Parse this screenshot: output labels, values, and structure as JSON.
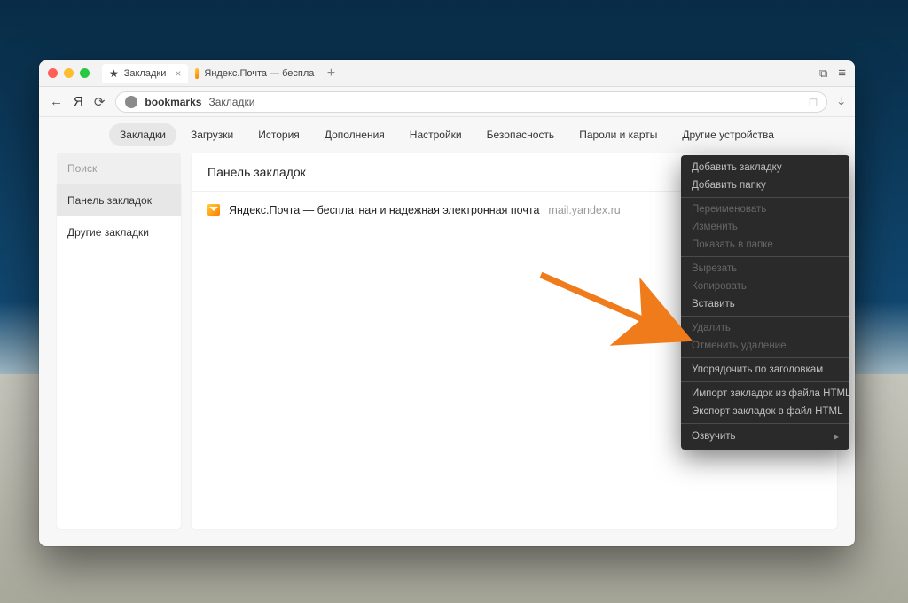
{
  "tabs": [
    {
      "title": "Закладки",
      "active": true
    },
    {
      "title": "Яндекс.Почта — беспла",
      "active": false
    }
  ],
  "omni": {
    "host": "bookmarks",
    "crumb": "Закладки"
  },
  "navtabs": {
    "items": [
      "Закладки",
      "Загрузки",
      "История",
      "Дополнения",
      "Настройки",
      "Безопасность",
      "Пароли и карты",
      "Другие устройства"
    ],
    "active_index": 0
  },
  "sidebar": {
    "search_placeholder": "Поиск",
    "items": [
      "Панель закладок",
      "Другие закладки"
    ],
    "active_index": 0
  },
  "main": {
    "heading": "Панель закладок",
    "bookmark": {
      "title": "Яндекс.Почта — бесплатная и надежная электронная почта",
      "url": "mail.yandex.ru"
    }
  },
  "context_menu": {
    "groups": [
      [
        {
          "label": "Добавить закладку",
          "enabled": true
        },
        {
          "label": "Добавить папку",
          "enabled": true
        }
      ],
      [
        {
          "label": "Переименовать",
          "enabled": false
        },
        {
          "label": "Изменить",
          "enabled": false
        },
        {
          "label": "Показать в папке",
          "enabled": false
        }
      ],
      [
        {
          "label": "Вырезать",
          "enabled": false
        },
        {
          "label": "Копировать",
          "enabled": false
        },
        {
          "label": "Вставить",
          "enabled": true
        }
      ],
      [
        {
          "label": "Удалить",
          "enabled": false
        },
        {
          "label": "Отменить удаление",
          "enabled": false
        }
      ],
      [
        {
          "label": "Упорядочить по заголовкам",
          "enabled": true
        }
      ],
      [
        {
          "label": "Импорт закладок из файла HTML",
          "enabled": true
        },
        {
          "label": "Экспорт закладок в файл HTML",
          "enabled": true
        }
      ],
      [
        {
          "label": "Озвучить",
          "enabled": true,
          "submenu": true
        }
      ]
    ]
  }
}
